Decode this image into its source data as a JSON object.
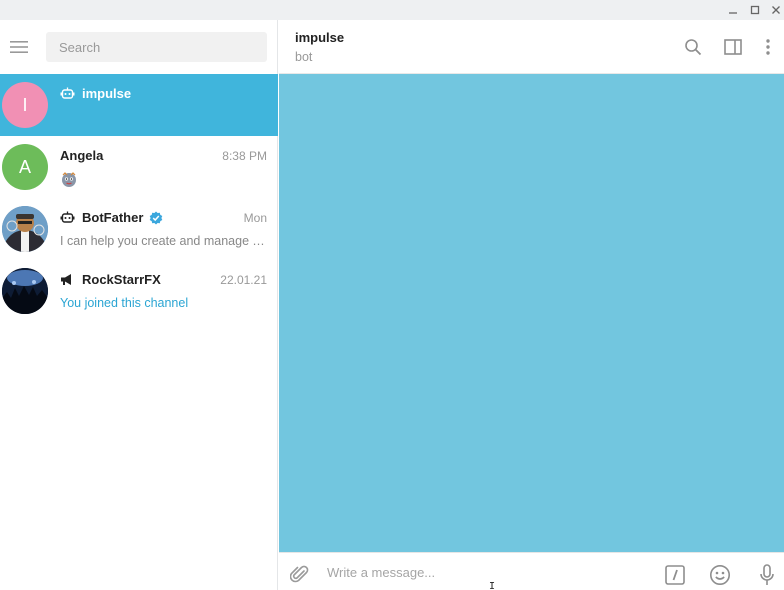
{
  "search": {
    "placeholder": "Search"
  },
  "chats": [
    {
      "name": "impulse",
      "avatar_letter": "I",
      "avatar_color": "#f190b4",
      "time": "",
      "preview": "",
      "type": "bot",
      "active": true
    },
    {
      "name": "Angela",
      "avatar_letter": "A",
      "avatar_color": "#6dbc5a",
      "time": "8:38 PM",
      "preview": "",
      "type": "user"
    },
    {
      "name": "BotFather",
      "time": "Mon",
      "preview": "I can help you create and manage Telegram bots.",
      "type": "bot",
      "verified": true
    },
    {
      "name": "RockStarrFX",
      "time": "22.01.21",
      "preview": "You joined this channel",
      "type": "channel"
    }
  ],
  "header": {
    "title": "impulse",
    "status": "bot"
  },
  "composer": {
    "placeholder": "Write a message..."
  },
  "colors": {
    "accent": "#40b5dc",
    "chat_background": "#72c6df",
    "link": "#2ba5d3"
  }
}
